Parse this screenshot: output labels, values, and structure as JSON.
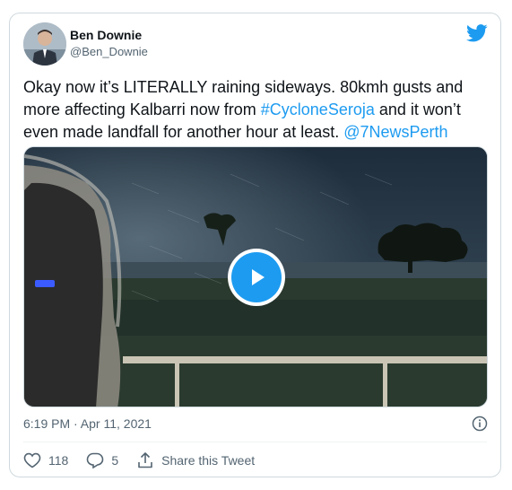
{
  "user": {
    "name": "Ben Downie",
    "handle": "@Ben_Downie"
  },
  "tweet": {
    "text_part1": "Okay now it’s LITERALLY raining sideways. 80kmh gusts and more affecting Kalbarri now from ",
    "hashtag": "#CycloneSeroja",
    "text_part2": " and it won’t even made landfall for another hour at least. ",
    "mention": "@7NewsPerth",
    "timestamp": "6:19 PM · Apr 11, 2021"
  },
  "actions": {
    "like_count": "118",
    "reply_count": "5",
    "share_label": "Share this Tweet"
  },
  "icons": {
    "brand": "twitter-bird-icon",
    "play": "play-icon",
    "info": "info-icon",
    "like": "heart-icon",
    "reply": "reply-icon",
    "share": "share-icon"
  },
  "colors": {
    "accent": "#1d9bf0",
    "text": "#0f1419",
    "secondary": "#536471"
  }
}
